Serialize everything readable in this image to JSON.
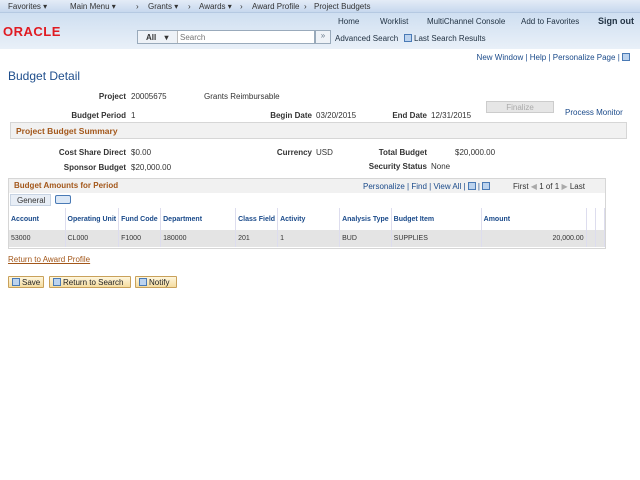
{
  "nav": {
    "favorites": "Favorites ▾",
    "main_menu": "Main Menu ▾",
    "grants": "Grants ▾",
    "awards": "Awards ▾",
    "award_profile": "Award Profile",
    "project_budgets": "Project Budgets",
    "sep": "›"
  },
  "header": {
    "logo": "ORACLE",
    "home": "Home",
    "worklist": "Worklist",
    "multichannel": "MultiChannel Console",
    "add_favorites": "Add to Favorites",
    "sign_out": "Sign out",
    "search_scope": "All",
    "search_placeholder": "Search",
    "advanced_search": "Advanced Search",
    "last_results": "Last Search Results"
  },
  "pagebar": {
    "new_window": "New Window",
    "help": "Help",
    "personalize_page": "Personalize Page"
  },
  "page": {
    "title": "Budget Detail",
    "project_label": "Project",
    "project_value": "20005675",
    "project_desc": "Grants Reimbursable",
    "period_label": "Budget Period",
    "period_value": "1",
    "begin_label": "Begin Date",
    "begin_value": "03/20/2015",
    "end_label": "End Date",
    "end_value": "12/31/2015",
    "finalize": "Finalize",
    "process_monitor": "Process Monitor",
    "summary_title": "Project Budget Summary",
    "cost_share_label": "Cost Share Direct",
    "cost_share_value": "$0.00",
    "currency_label": "Currency",
    "currency_value": "USD",
    "total_label": "Total Budget",
    "total_value": "$20,000.00",
    "sponsor_label": "Sponsor Budget",
    "sponsor_value": "$20,000.00",
    "security_label": "Security Status",
    "security_value": "None"
  },
  "grid": {
    "title": "Budget Amounts for Period",
    "personalize": "Personalize",
    "find": "Find",
    "view_all": "View All",
    "first": "First",
    "count": "1 of 1",
    "last": "Last",
    "tab": "General",
    "columns": [
      "Account",
      "Operating Unit",
      "Fund Code",
      "Department",
      "Class Field",
      "Activity",
      "Analysis Type",
      "Budget Item",
      "Amount"
    ],
    "rows": [
      [
        "53000",
        "CL000",
        "F1000",
        "180000",
        "201",
        "1",
        "BUD",
        "SUPPLIES",
        "20,000.00"
      ]
    ]
  },
  "footer": {
    "return_award": "Return to Award Profile",
    "save": "Save",
    "return_search": "Return to Search",
    "notify": "Notify"
  }
}
